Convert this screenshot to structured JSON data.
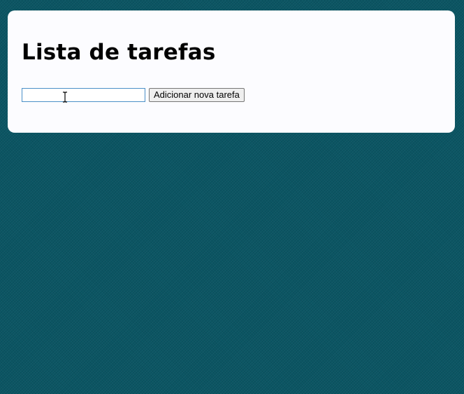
{
  "page": {
    "title": "Lista de tarefas"
  },
  "form": {
    "input_value": "",
    "input_placeholder": "",
    "add_button_label": "Adicionar nova tarefa"
  },
  "icons": {
    "mouse_cursor": "text-cursor-icon"
  },
  "colors": {
    "background": "#0b5563",
    "card": "#fcfcff",
    "input_focus_border": "#4a90c8"
  }
}
